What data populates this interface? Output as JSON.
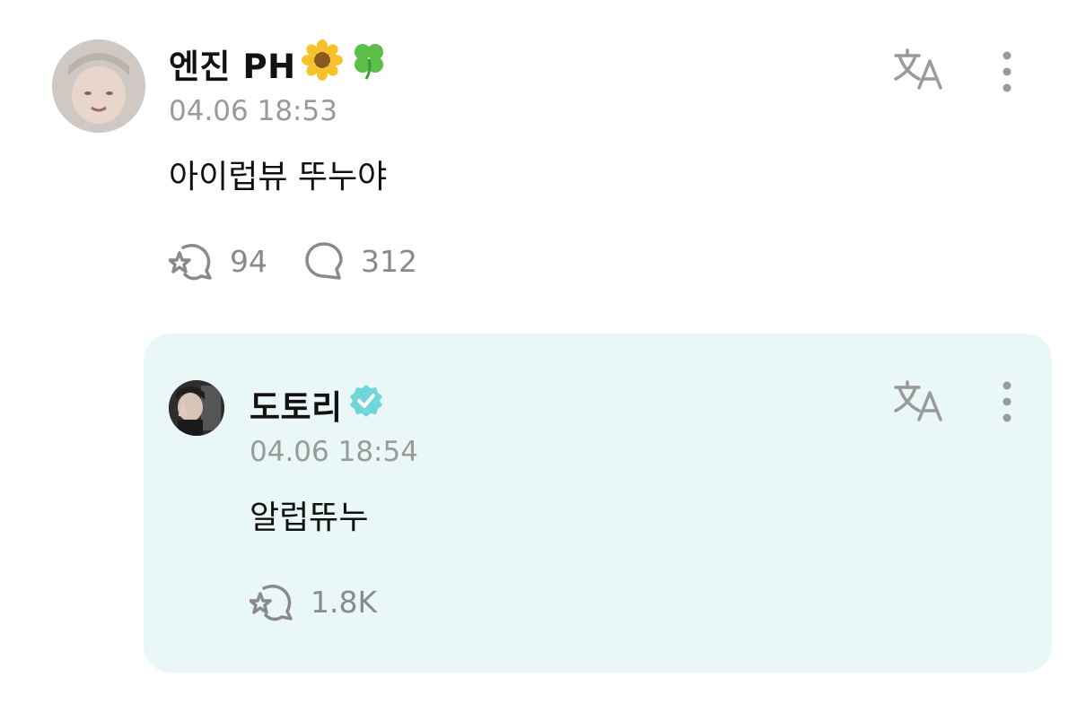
{
  "post": {
    "author": "엔진 PH",
    "timestamp": "04.06 18:53",
    "text": "아이럽뷰 뚜누야",
    "like_count": "94",
    "comment_count": "312",
    "avatar_icon": "user-photo",
    "badges": [
      "sunflower-emoji",
      "four-leaf-clover-emoji"
    ]
  },
  "reply": {
    "author": "도토리",
    "timestamp": "04.06 18:54",
    "text": "알럽뜌누",
    "like_count": "1.8K",
    "avatar_icon": "user-photo",
    "verified_icon": "verified-badge-icon"
  },
  "icons": {
    "translate": "translate-icon",
    "more": "more-options-icon",
    "like": "like-icon",
    "comment": "comment-icon"
  },
  "colors": {
    "background": "#ffffff",
    "reply_background": "#e9f8f6",
    "muted_text": "#9a9a9a",
    "icon_gray": "#8a8a8a",
    "verified": "#6fd6d9"
  }
}
